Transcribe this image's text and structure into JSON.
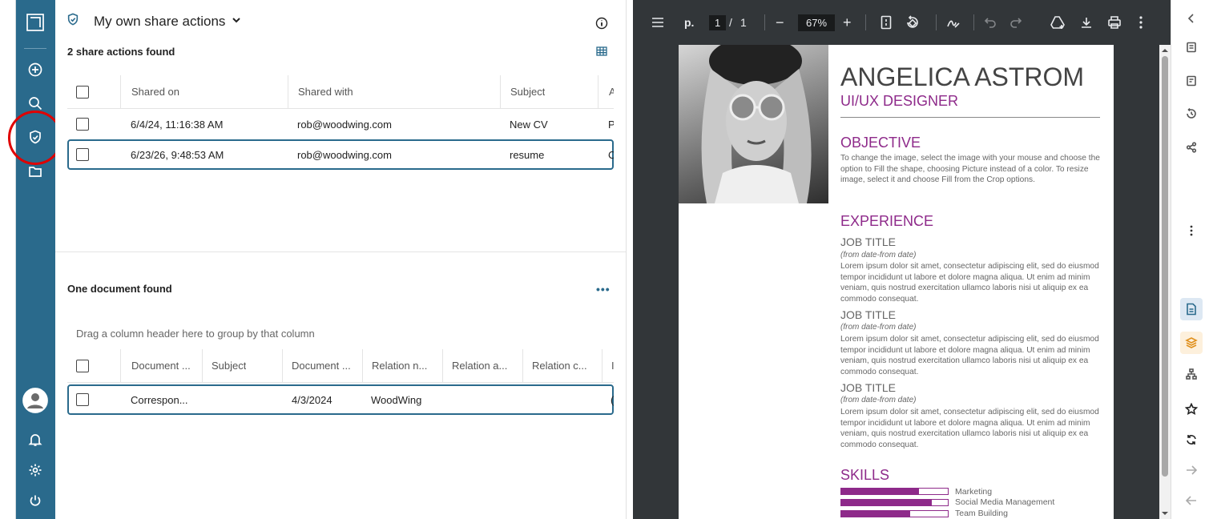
{
  "sidebar": {
    "items": [
      {
        "name": "app-logo-icon"
      },
      {
        "name": "add-icon"
      },
      {
        "name": "search-icon"
      },
      {
        "name": "share-shield-icon"
      },
      {
        "name": "folder-icon"
      },
      {
        "name": "avatar-icon"
      },
      {
        "name": "bell-icon"
      },
      {
        "name": "gear-icon"
      },
      {
        "name": "power-icon"
      }
    ]
  },
  "share_panel": {
    "title": "My own share actions",
    "count_label": "2 share actions found",
    "columns": [
      "Shared on",
      "Shared with",
      "Subject",
      "A"
    ],
    "rows": [
      {
        "shared_on": "6/4/24, 11:16:38 AM",
        "shared_with": "rob@woodwing.com",
        "subject": "New CV",
        "extra": "P"
      },
      {
        "shared_on": "6/23/26, 9:48:53 AM",
        "shared_with": "rob@woodwing.com",
        "subject": "resume",
        "extra": "C"
      }
    ]
  },
  "doc_panel": {
    "count_label": "One document found",
    "more_label": "•••",
    "drag_hint": "Drag a column header here to group by that column",
    "columns": [
      "Document ...",
      "Subject",
      "Document ...",
      "Relation n...",
      "Relation a...",
      "Relation c...",
      "I"
    ],
    "rows": [
      {
        "doc_name": "Correspon...",
        "subject": "",
        "doc_date": "4/3/2024",
        "relation_name": "WoodWing",
        "relation_a": "",
        "relation_c": "",
        "extra": "("
      }
    ]
  },
  "viewer": {
    "page_prefix": "p.",
    "page_current": "1",
    "page_sep": "/",
    "page_total": "1",
    "zoom": "67%",
    "zoom_minus": "−",
    "zoom_plus": "+",
    "cv": {
      "name": "ANGELICA ASTROM",
      "role": "UI/UX DESIGNER",
      "objective_heading": "OBJECTIVE",
      "objective_text": "To change the image, select the image with your mouse and choose the option to Fill the shape, choosing Picture instead of a color.  To resize image, select it and choose Fill from the Crop options.",
      "experience_heading": "EXPERIENCE",
      "jobs": [
        {
          "title": "JOB TITLE",
          "dates": "(from date-from date)",
          "text": "Lorem ipsum dolor sit amet, consectetur adipiscing elit, sed do eiusmod tempor incididunt ut labore et dolore magna aliqua. Ut enim ad minim veniam, quis nostrud exercitation ullamco laboris nisi ut aliquip ex ea commodo consequat."
        },
        {
          "title": "JOB TITLE",
          "dates": "(from date-from date)",
          "text": "Lorem ipsum dolor sit amet, consectetur adipiscing elit, sed do eiusmod tempor incididunt ut labore et dolore magna aliqua. Ut enim ad minim veniam, quis nostrud exercitation ullamco laboris nisi ut aliquip ex ea commodo consequat."
        },
        {
          "title": "JOB TITLE",
          "dates": "(from date-from date)",
          "text": "Lorem ipsum dolor sit amet, consectetur adipiscing elit, sed do eiusmod tempor incididunt ut labore et dolore magna aliqua. Ut enim ad minim veniam, quis nostrud exercitation ullamco laboris nisi ut aliquip ex ea commodo consequat."
        }
      ],
      "skills_heading": "SKILLS",
      "skills": [
        {
          "label": "Marketing",
          "level": 0.73
        },
        {
          "label": "Social Media Management",
          "level": 0.85
        },
        {
          "label": "Team Building",
          "level": 0.65
        }
      ]
    }
  },
  "colors": {
    "rail": "#2a6a8c",
    "accent_purple": "#8e2a8a",
    "viewer_dark": "#323639",
    "highlight_ring": "#e00000"
  }
}
